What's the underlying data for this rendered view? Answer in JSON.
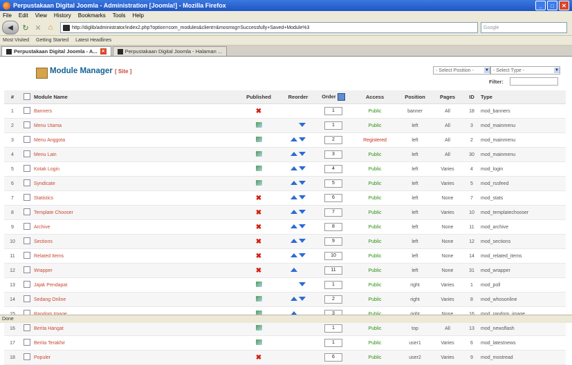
{
  "window": {
    "title": "Perpustakaan Digital Joomla - Administration [Joomla!] - Mozilla Firefox"
  },
  "menu": [
    "File",
    "Edit",
    "View",
    "History",
    "Bookmarks",
    "Tools",
    "Help"
  ],
  "nav": {
    "url": "http://diglib/administrator/index2.php?option=com_modules&client=&mosmsg=Successfully+Saved+Module%3",
    "search_placeholder": "Google"
  },
  "bookmarks": [
    "Most Visited",
    "Getting Started",
    "Latest Headlines"
  ],
  "tabs": [
    {
      "label": "Perpustakaan Digital Joomla - A...",
      "active": true
    },
    {
      "label": "Perpustakaan Digital Joomla - Halaman ...",
      "active": false
    }
  ],
  "page": {
    "title": "Module Manager",
    "subtitle": "[ Site ]",
    "select_position": "- Select Position -",
    "select_type": "- Select Type -",
    "filter_label": "Filter:"
  },
  "table": {
    "headers": {
      "num": "#",
      "name": "Module Name",
      "published": "Published",
      "reorder": "Reorder",
      "order": "Order",
      "access": "Access",
      "position": "Position",
      "pages": "Pages",
      "id": "ID",
      "type": "Type"
    },
    "rows": [
      {
        "num": "1",
        "name": "Banners",
        "published": false,
        "up": false,
        "down": false,
        "order": "1",
        "access": "Public",
        "position": "banner",
        "pages": "All",
        "id": "18",
        "type": "mod_banners"
      },
      {
        "num": "2",
        "name": "Menu Utama",
        "published": true,
        "up": false,
        "down": true,
        "order": "1",
        "access": "Public",
        "position": "left",
        "pages": "All",
        "id": "3",
        "type": "mod_mainmenu"
      },
      {
        "num": "3",
        "name": "Menu Anggota",
        "published": true,
        "up": true,
        "down": true,
        "order": "2",
        "access": "Registered",
        "position": "left",
        "pages": "All",
        "id": "2",
        "type": "mod_mainmenu"
      },
      {
        "num": "4",
        "name": "Menu Lain",
        "published": true,
        "up": true,
        "down": true,
        "order": "3",
        "access": "Public",
        "position": "left",
        "pages": "All",
        "id": "30",
        "type": "mod_mainmenu"
      },
      {
        "num": "5",
        "name": "Kotak Login",
        "published": true,
        "up": true,
        "down": true,
        "order": "4",
        "access": "Public",
        "position": "left",
        "pages": "Varies",
        "id": "4",
        "type": "mod_login"
      },
      {
        "num": "6",
        "name": "Syndicate",
        "published": true,
        "up": true,
        "down": true,
        "order": "5",
        "access": "Public",
        "position": "left",
        "pages": "Varies",
        "id": "5",
        "type": "mod_rssfeed"
      },
      {
        "num": "7",
        "name": "Statistics",
        "published": false,
        "up": true,
        "down": true,
        "order": "6",
        "access": "Public",
        "position": "left",
        "pages": "None",
        "id": "7",
        "type": "mod_stats"
      },
      {
        "num": "8",
        "name": "Template Chooser",
        "published": false,
        "up": true,
        "down": true,
        "order": "7",
        "access": "Public",
        "position": "left",
        "pages": "Varies",
        "id": "10",
        "type": "mod_templatechooser"
      },
      {
        "num": "9",
        "name": "Archive",
        "published": false,
        "up": true,
        "down": true,
        "order": "8",
        "access": "Public",
        "position": "left",
        "pages": "None",
        "id": "11",
        "type": "mod_archive"
      },
      {
        "num": "10",
        "name": "Sections",
        "published": false,
        "up": true,
        "down": true,
        "order": "9",
        "access": "Public",
        "position": "left",
        "pages": "None",
        "id": "12",
        "type": "mod_sections"
      },
      {
        "num": "11",
        "name": "Related Items",
        "published": false,
        "up": true,
        "down": true,
        "order": "10",
        "access": "Public",
        "position": "left",
        "pages": "None",
        "id": "14",
        "type": "mod_related_items"
      },
      {
        "num": "12",
        "name": "Wrapper",
        "published": false,
        "up": true,
        "down": false,
        "order": "11",
        "access": "Public",
        "position": "left",
        "pages": "None",
        "id": "31",
        "type": "mod_wrapper"
      },
      {
        "num": "13",
        "name": "Jajak Pendapat",
        "published": true,
        "up": false,
        "down": true,
        "order": "1",
        "access": "Public",
        "position": "right",
        "pages": "Varies",
        "id": "1",
        "type": "mod_poll"
      },
      {
        "num": "14",
        "name": "Sedang Online",
        "published": true,
        "up": true,
        "down": true,
        "order": "2",
        "access": "Public",
        "position": "right",
        "pages": "Varies",
        "id": "8",
        "type": "mod_whosonline"
      },
      {
        "num": "15",
        "name": "Random Image",
        "published": true,
        "up": true,
        "down": false,
        "order": "3",
        "access": "Public",
        "position": "right",
        "pages": "None",
        "id": "16",
        "type": "mod_random_image"
      },
      {
        "num": "16",
        "name": "Berita Hangat",
        "published": true,
        "up": false,
        "down": false,
        "order": "1",
        "access": "Public",
        "position": "top",
        "pages": "All",
        "id": "13",
        "type": "mod_newsflash"
      },
      {
        "num": "17",
        "name": "Berita Terakhir",
        "published": true,
        "up": false,
        "down": false,
        "order": "1",
        "access": "Public",
        "position": "user1",
        "pages": "Varies",
        "id": "6",
        "type": "mod_latestnews"
      },
      {
        "num": "18",
        "name": "Populer",
        "published": false,
        "up": false,
        "down": false,
        "order": "6",
        "access": "Public",
        "position": "user2",
        "pages": "Varies",
        "id": "9",
        "type": "mod_mostread"
      }
    ]
  },
  "status": "Done"
}
